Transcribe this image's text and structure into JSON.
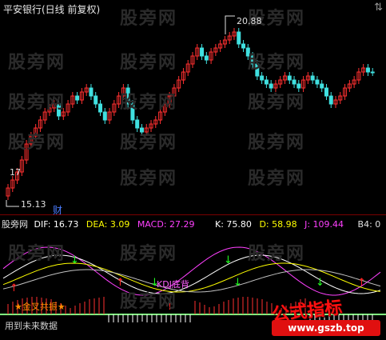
{
  "header": {
    "title": "平安银行(日线 前复权)",
    "scroll_arrow": "⇅"
  },
  "price_panel": {
    "high_label": "20.88",
    "low_label": "15.13",
    "mid_label": "17",
    "finance_marker": "财"
  },
  "indicator_panel": {
    "name": "股旁网",
    "dif": "DIF: 16.73",
    "dea": "DEA: 3.09",
    "macd": "MACD: 27.29",
    "k": "K: 75.80",
    "d": "D: 58.98",
    "j": "J: 109.44",
    "b4": "B4: 0",
    "annotations": {
      "resonance": "KDJ底背",
      "golden_cross": "金叉共振",
      "future_data": "用到未来数据"
    }
  },
  "watermarks": {
    "site": "股旁网",
    "formula_title": "公式指标",
    "url": "www.gszb.top"
  },
  "colors": {
    "up": "#ff3030",
    "down": "#40e0e0",
    "dif_line": "#ffffff",
    "dea_line": "#ffff00",
    "macd_text": "#ff40ff",
    "k_line": "#ffffff",
    "d_line": "#ffff00",
    "j_line": "#ff40ff",
    "baseline": "#80ff80",
    "arrow_up": "#ff2020",
    "arrow_down": "#20ff20",
    "formula_red": "#ff1010"
  }
}
